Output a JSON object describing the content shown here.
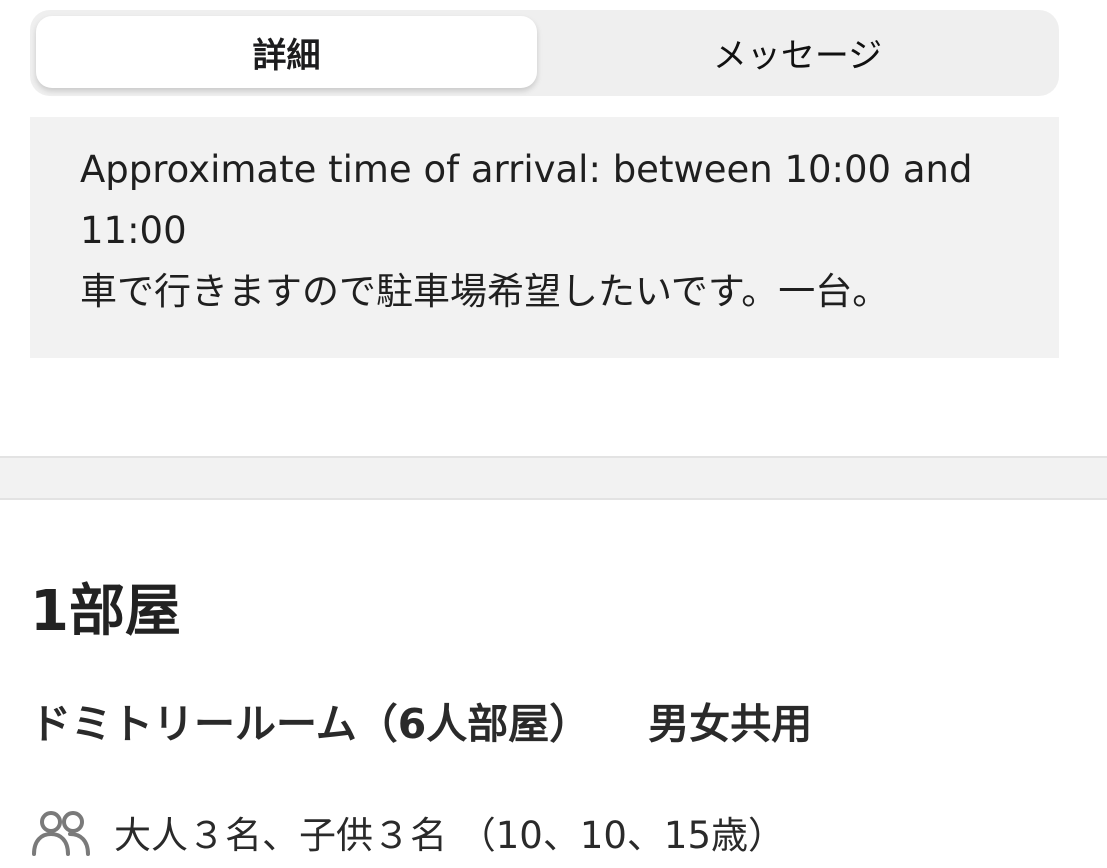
{
  "tabs": [
    {
      "label": "詳細",
      "active": true
    },
    {
      "label": "メッセージ",
      "active": false
    }
  ],
  "note": {
    "lines": [
      "Approximate time of arrival: between 10:00 and",
      "11:00",
      "車で行きますので駐車場希望したいです。一台。"
    ]
  },
  "rooms": {
    "count_label": "1部屋",
    "room_type": "ドミトリールーム（6人部屋）",
    "gender": "男女共用",
    "guests_icon": "people-icon",
    "guests_text": "大人３名、子供３名 （10、10、15歳）"
  },
  "colors": {
    "segment_bg": "#efefef",
    "note_bg": "#f2f2f2",
    "divider_bg": "#f2f2f2"
  }
}
